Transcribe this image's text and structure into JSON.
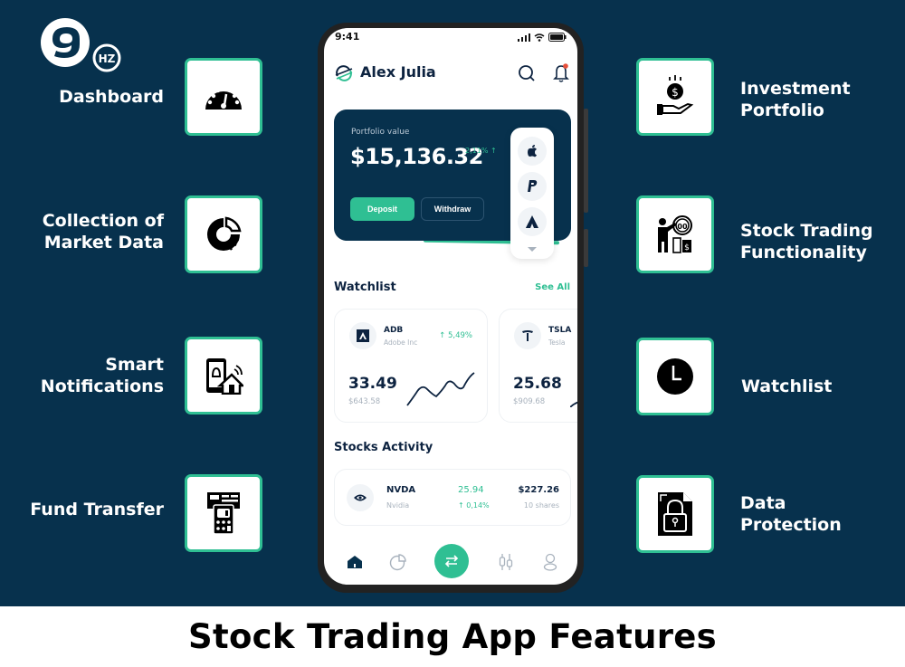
{
  "brand": {
    "logo_mark": "9",
    "logo_sub": "HZ"
  },
  "colors": {
    "background": "#07314d",
    "accent": "#2fbf93",
    "text_dark": "#0d2340",
    "muted": "#a8b2bd",
    "notification_dot": "#e8503a"
  },
  "features_left": [
    {
      "label_line1": "Dashboard",
      "label_line2": "",
      "icon": "speedometer-icon"
    },
    {
      "label_line1": "Collection of",
      "label_line2": "Market Data",
      "icon": "donut-chart-icon"
    },
    {
      "label_line1": "Smart",
      "label_line2": "Notifications",
      "icon": "smart-notification-icon"
    },
    {
      "label_line1": "Fund Transfer",
      "label_line2": "",
      "icon": "card-terminal-icon"
    }
  ],
  "features_right": [
    {
      "label_line1": "Investment",
      "label_line2": "Portfolio",
      "icon": "hand-coin-icon"
    },
    {
      "label_line1": "Stock Trading",
      "label_line2": "Functionality",
      "icon": "trader-icon"
    },
    {
      "label_line1": "Watchlist",
      "label_line2": "",
      "icon": "clock-icon"
    },
    {
      "label_line1": "Data",
      "label_line2": "Protection",
      "icon": "locked-file-icon"
    }
  ],
  "phone": {
    "status": {
      "time": "9:41"
    },
    "header": {
      "user_name": "Alex Julia"
    },
    "portfolio": {
      "label": "Portfolio value",
      "value": "$15,136.32",
      "change": "2,11% ↑",
      "deposit_label": "Deposit",
      "withdraw_label": "Withdraw",
      "payment_methods": [
        "apple-pay-icon",
        "paypal-icon",
        "atlassian-icon"
      ]
    },
    "watchlist": {
      "title": "Watchlist",
      "see_all": "See All",
      "items": [
        {
          "ticker": "ADB",
          "company": "Adobe Inc",
          "change": "↑ 5,49%",
          "price": "33.49",
          "value": "$643.58"
        },
        {
          "ticker": "TSLA",
          "company": "Tesla",
          "change": "",
          "price": "25.68",
          "value": "$909.68"
        }
      ]
    },
    "activity": {
      "title": "Stocks Activity",
      "items": [
        {
          "ticker": "NVDA",
          "company": "Nvidia",
          "price": "25.94",
          "change": "↑ 0,14%",
          "total": "$227.26",
          "shares": "10 shares"
        }
      ]
    },
    "nav": [
      "home",
      "portfolio",
      "transfer",
      "market",
      "profile"
    ]
  },
  "footer": {
    "title": "Stock Trading App Features"
  }
}
